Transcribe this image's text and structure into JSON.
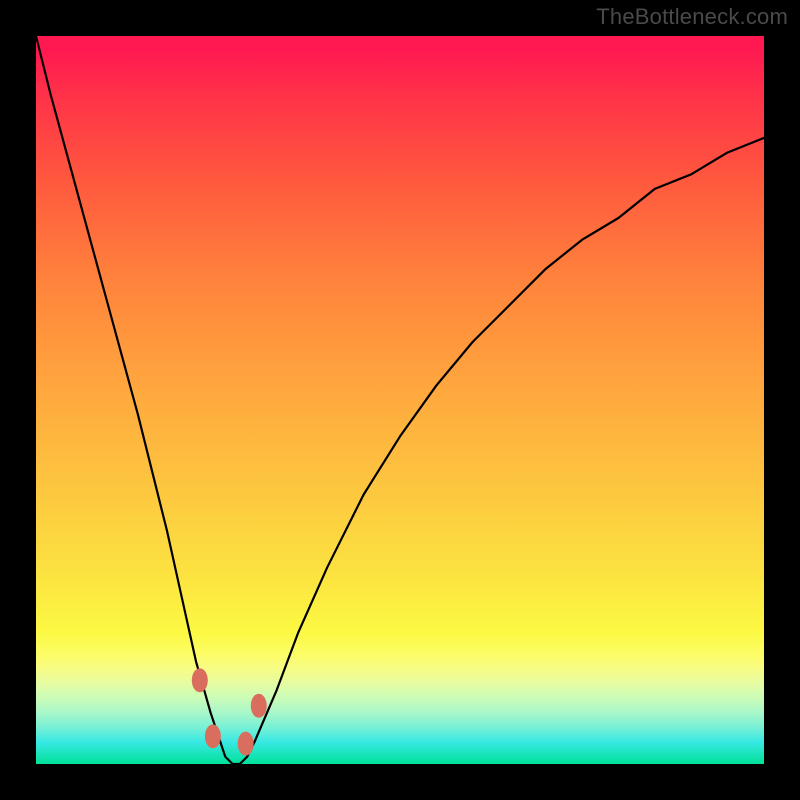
{
  "watermark": "TheBottleneck.com",
  "colors": {
    "background": "#000000",
    "curve": "#000000",
    "marker": "#d96e5e",
    "gradient_top": "#ff1950",
    "gradient_bottom": "#00e199"
  },
  "chart_data": {
    "type": "line",
    "title": "",
    "xlabel": "",
    "ylabel": "",
    "xlim": [
      0,
      100
    ],
    "ylim": [
      0,
      100
    ],
    "x": [
      0,
      2,
      5,
      8,
      11,
      14,
      16,
      18,
      20,
      22,
      24,
      25,
      26,
      27,
      28,
      29,
      30,
      33,
      36,
      40,
      45,
      50,
      55,
      60,
      65,
      70,
      75,
      80,
      85,
      90,
      95,
      100
    ],
    "values": [
      100,
      92,
      81,
      70,
      59,
      48,
      40,
      32,
      23,
      14,
      7,
      4,
      1,
      0,
      0,
      1,
      3,
      10,
      18,
      27,
      37,
      45,
      52,
      58,
      63,
      68,
      72,
      75,
      79,
      81,
      84,
      86
    ],
    "markers": [
      {
        "x": 22.5,
        "y": 11.5
      },
      {
        "x": 24.3,
        "y": 3.8
      },
      {
        "x": 28.8,
        "y": 2.8
      },
      {
        "x": 30.6,
        "y": 8.0
      }
    ],
    "annotations": []
  }
}
